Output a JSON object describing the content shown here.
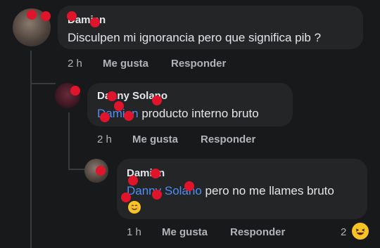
{
  "comments": [
    {
      "author": "Damian",
      "text": "Disculpen mi ignorancia pero que significa pib ?",
      "time": "2 h",
      "like_label": "Me gusta",
      "reply_label": "Responder"
    },
    {
      "author": "Danny Solano",
      "mention": "Damian",
      "text": " producto interno bruto",
      "time": "2 h",
      "like_label": "Me gusta",
      "reply_label": "Responder"
    },
    {
      "author": "Damian",
      "mention": "Danny Solano",
      "text": " pero no me llames bruto",
      "time": "1 h",
      "like_label": "Me gusta",
      "reply_label": "Responder",
      "reaction_count": "2"
    }
  ],
  "icons": {
    "reaction": "laughing-emoji-icon",
    "inline_emoji": "smiling-emoji-icon"
  },
  "colors": {
    "background": "#18191a",
    "bubble": "#242526",
    "mention": "#4e8ef7",
    "muted_text": "#b0b3b8",
    "redaction": "#e0142a"
  }
}
